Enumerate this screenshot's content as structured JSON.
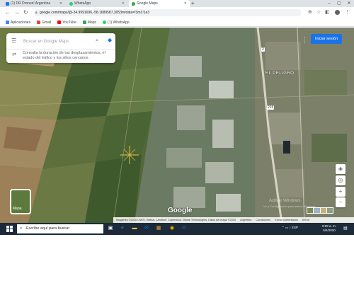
{
  "browser": {
    "tabs": [
      {
        "label": "(1) DR Drones! Argentina",
        "active": false
      },
      {
        "label": "WhatsApp",
        "active": false
      },
      {
        "label": "Google Maps",
        "active": true
      }
    ],
    "new_tab": "+",
    "window_controls": [
      "–",
      "▢",
      "✕"
    ],
    "address": "google.com/maps/@-34.9991696,-58.1689587,3053m/data=!3m1!1e3",
    "bookmarks": [
      {
        "label": "Aplicaciones",
        "color": "#4285f4"
      },
      {
        "label": "Gmail",
        "color": "#ea4335"
      },
      {
        "label": "YouTube",
        "color": "#ff0000"
      },
      {
        "label": "Maps",
        "color": "#34a853"
      },
      {
        "label": "(1) WhatsApp",
        "color": "#25d366"
      }
    ]
  },
  "maps": {
    "search_placeholder": "Buscar en Google Maps",
    "hint_text": "Consulta la duración de tus desplazamientos, el estado del tráfico y los sitios cercanos",
    "signin_label": "Iniciar sesión",
    "place_label": "EL PELIGRO",
    "route_markers": [
      "2",
      "215"
    ],
    "layers_label": "Mapa",
    "logo": "Google",
    "watermark_line1": "Activar Windows",
    "watermark_line2": "Ve a Configuración para activar Windows.",
    "footer": [
      "Imágenes ©2020 CNES / Airbus, Landsat / Copernicus, Maxar Technologies, Datos del mapa ©2020",
      "Argentina",
      "Condiciones",
      "Enviar comentarios",
      "500 m"
    ]
  },
  "taskbar": {
    "search_placeholder": "Escribe aquí para buscar",
    "tray": "ESP",
    "time": "9:09 a. m.",
    "date": "5/4/2020"
  },
  "colors": {
    "accent": "#1a73e8",
    "taskbar": "#1c2a3a"
  }
}
